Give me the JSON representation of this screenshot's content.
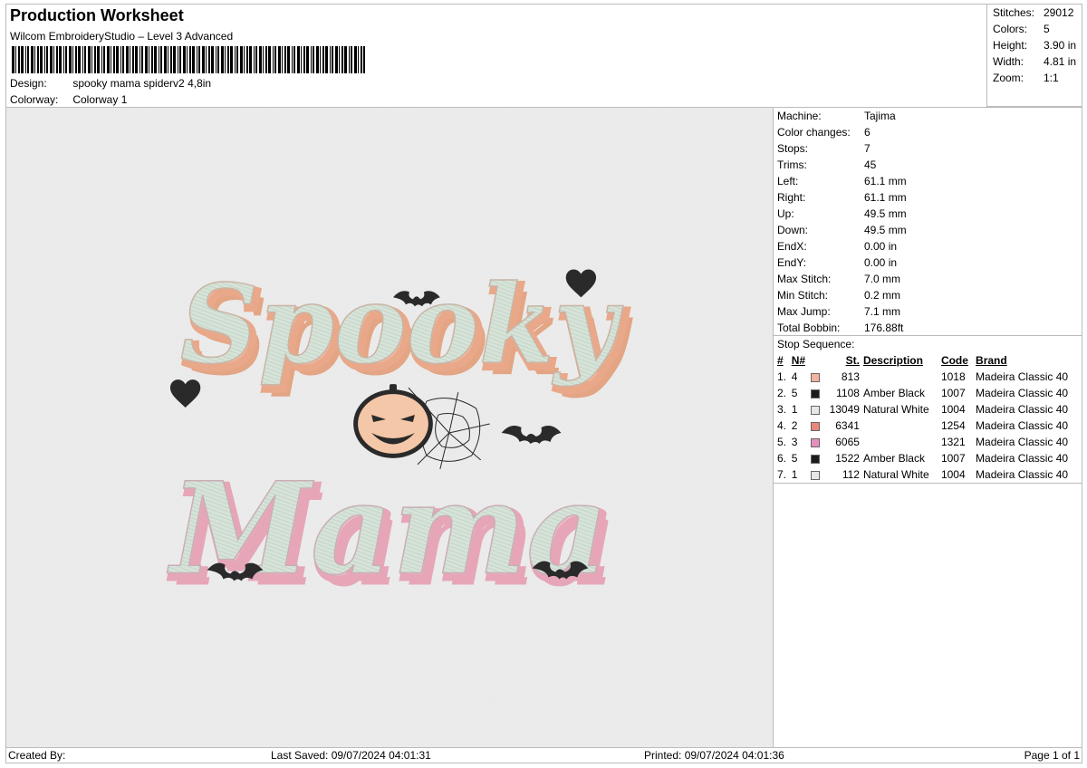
{
  "header": {
    "title": "Production Worksheet",
    "software": "Wilcom EmbroideryStudio – Level 3 Advanced",
    "design_label": "Design:",
    "design_value": "spooky mama spiderv2 4,8in",
    "colorway_label": "Colorway:",
    "colorway_value": "Colorway 1"
  },
  "summary": {
    "stitches_label": "Stitches:",
    "stitches": "29012",
    "colors_label": "Colors:",
    "colors": "5",
    "height_label": "Height:",
    "height": "3.90 in",
    "width_label": "Width:",
    "width": "4.81 in",
    "zoom_label": "Zoom:",
    "zoom": "1:1"
  },
  "details": {
    "machine_label": "Machine:",
    "machine": "Tajima",
    "color_changes_label": "Color changes:",
    "color_changes": "6",
    "stops_label": "Stops:",
    "stops": "7",
    "trims_label": "Trims:",
    "trims": "45",
    "left_label": "Left:",
    "left": "61.1 mm",
    "right_label": "Right:",
    "right": "61.1 mm",
    "up_label": "Up:",
    "up": "49.5 mm",
    "down_label": "Down:",
    "down": "49.5 mm",
    "endx_label": "EndX:",
    "endx": "0.00 in",
    "endy_label": "EndY:",
    "endy": "0.00 in",
    "max_stitch_label": "Max Stitch:",
    "max_stitch": "7.0 mm",
    "min_stitch_label": "Min Stitch:",
    "min_stitch": "0.2 mm",
    "max_jump_label": "Max Jump:",
    "max_jump": "7.1 mm",
    "total_bobbin_label": "Total Bobbin:",
    "total_bobbin": "176.88ft"
  },
  "stop_sequence": {
    "label": "Stop Sequence:",
    "columns": [
      "#",
      "N#",
      "St.",
      "Description",
      "Code",
      "Brand"
    ],
    "rows": [
      {
        "idx": "1.",
        "n": "4",
        "color": "#f2b4a0",
        "st": "813",
        "desc": "",
        "code": "1018",
        "brand": "Madeira Classic 40"
      },
      {
        "idx": "2.",
        "n": "5",
        "color": "#1c1c1c",
        "st": "1108",
        "desc": "Amber Black",
        "code": "1007",
        "brand": "Madeira Classic 40"
      },
      {
        "idx": "3.",
        "n": "1",
        "color": "#e4e6e8",
        "st": "13049",
        "desc": "Natural White",
        "code": "1004",
        "brand": "Madeira Classic 40"
      },
      {
        "idx": "4.",
        "n": "2",
        "color": "#e8877a",
        "st": "6341",
        "desc": "",
        "code": "1254",
        "brand": "Madeira Classic 40"
      },
      {
        "idx": "5.",
        "n": "3",
        "color": "#e58fbf",
        "st": "6065",
        "desc": "",
        "code": "1321",
        "brand": "Madeira Classic 40"
      },
      {
        "idx": "6.",
        "n": "5",
        "color": "#1c1c1c",
        "st": "1522",
        "desc": "Amber Black",
        "code": "1007",
        "brand": "Madeira Classic 40"
      },
      {
        "idx": "7.",
        "n": "1",
        "color": "#e4e6e8",
        "st": "112",
        "desc": "Natural White",
        "code": "1004",
        "brand": "Madeira Classic 40"
      }
    ]
  },
  "design_art": {
    "word1": "Spooky",
    "word2": "Mama",
    "colors": {
      "peach": "#f2b79b",
      "pink": "#f0bccb",
      "mint": "#d6e3d8",
      "black": "#2a2a2a",
      "pumpkin": "#f4c7a8"
    }
  },
  "footer": {
    "created_by": "Created By:",
    "last_saved": "Last Saved: 09/07/2024 04:01:31",
    "printed": "Printed: 09/07/2024 04:01:36",
    "page": "Page 1 of 1"
  }
}
